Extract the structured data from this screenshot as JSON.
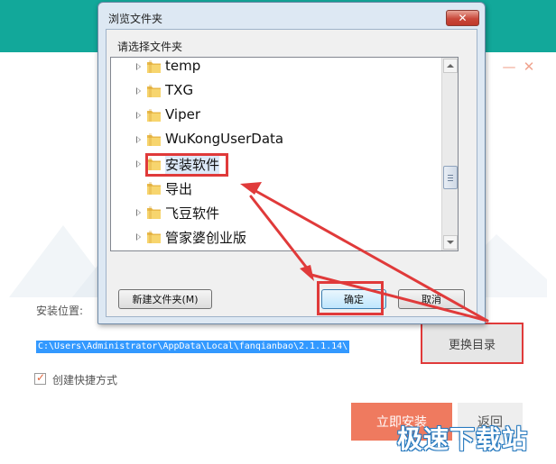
{
  "installer": {
    "install_location_label": "安装位置:",
    "path_value": "C:\\Users\\Administrator\\AppData\\Local\\fanqianbao\\2.1.1.14\\",
    "change_directory_label": "更换目录",
    "shortcut_label": "创建快捷方式",
    "shortcut_checked": true,
    "install_now_label": "立即安装",
    "back_label": "返回",
    "minimize_glyph": "—",
    "close_glyph": "✕",
    "colors": {
      "header": "#12a89a",
      "accent": "#ef7a5f",
      "highlight": "#e03a3a"
    }
  },
  "dialog": {
    "title": "浏览文件夹",
    "close_glyph": "✕",
    "prompt": "请选择文件夹",
    "folders": [
      {
        "label": "temp",
        "expandable": true,
        "selected": false
      },
      {
        "label": "TXG",
        "expandable": true,
        "selected": false
      },
      {
        "label": "Viper",
        "expandable": true,
        "selected": false
      },
      {
        "label": "WuKongUserData",
        "expandable": true,
        "selected": false
      },
      {
        "label": "安装软件",
        "expandable": true,
        "selected": true
      },
      {
        "label": "导出",
        "expandable": false,
        "selected": false
      },
      {
        "label": "飞豆软件",
        "expandable": true,
        "selected": false
      },
      {
        "label": "管家婆创业版",
        "expandable": true,
        "selected": false
      }
    ],
    "new_folder_label": "新建文件夹(M)",
    "ok_label": "确定",
    "cancel_label": "取消"
  },
  "watermark": "极速下载站"
}
